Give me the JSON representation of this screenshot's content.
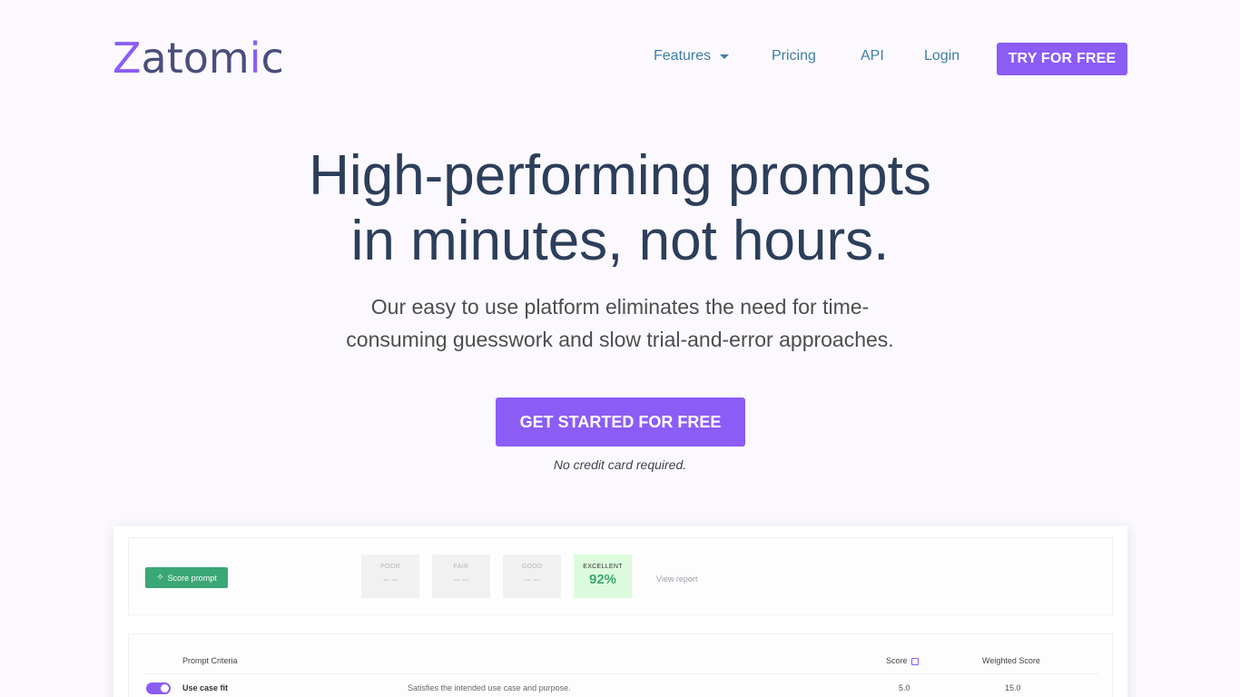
{
  "brand": {
    "logo_part1": "Z",
    "logo_part2": "atom",
    "logo_part3": "i",
    "logo_part4": "c"
  },
  "nav": {
    "features": "Features",
    "pricing": "Pricing",
    "api": "API",
    "login": "Login",
    "try_button": "TRY FOR FREE"
  },
  "hero": {
    "title_line1": "High-performing prompts",
    "title_line2": "in minutes, not hours.",
    "subtitle_line1": "Our easy to use platform eliminates the need for time-",
    "subtitle_line2": "consuming guesswork and slow trial-and-error approaches.",
    "cta": "GET STARTED FOR FREE",
    "note": "No credit card required."
  },
  "preview": {
    "score_button": "Score prompt",
    "grades": [
      {
        "label": "POOR",
        "value": "-- --"
      },
      {
        "label": "FAIR",
        "value": "-- --"
      },
      {
        "label": "GOOD",
        "value": "-- --"
      },
      {
        "label": "EXCELLENT",
        "value": "92%"
      }
    ],
    "view_report": "View report",
    "table": {
      "headers": {
        "criteria": "Prompt Criteria",
        "score": "Score",
        "weighted": "Weighted Score"
      },
      "rows": [
        {
          "name": "Use case fit",
          "description": "Satisfies the intended use case and purpose.",
          "score": "5.0",
          "weighted": "15.0",
          "enabled": true
        }
      ]
    }
  },
  "colors": {
    "accent": "#8b5cf6",
    "nav_link": "#3f7ea5",
    "heading": "#2c3e5a",
    "success": "#3aa776",
    "background": "#fbf9fe"
  }
}
